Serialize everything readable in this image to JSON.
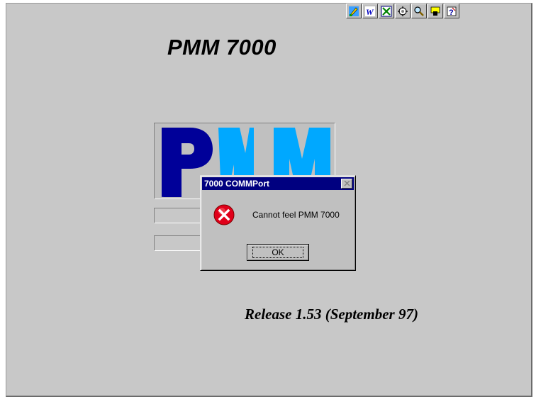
{
  "app": {
    "title": "PMM 7000",
    "release": "Release 1.53 (September 97)"
  },
  "toolbar": {
    "icons": [
      "paint-icon",
      "word-icon",
      "excel-icon",
      "settings-icon",
      "search-icon",
      "highlight-icon",
      "help-icon"
    ]
  },
  "logo": {
    "text": "PMM",
    "colors": {
      "dark_blue": "#000099",
      "light_blue": "#00a8ff"
    }
  },
  "dialog": {
    "title": "7000 COMMPort",
    "message": "Cannot feel PMM 7000",
    "ok_label": "OK",
    "icon": "error-icon"
  },
  "colors": {
    "background": "#c8c8c8",
    "titlebar": "#000080",
    "error_red": "#e0001a"
  }
}
